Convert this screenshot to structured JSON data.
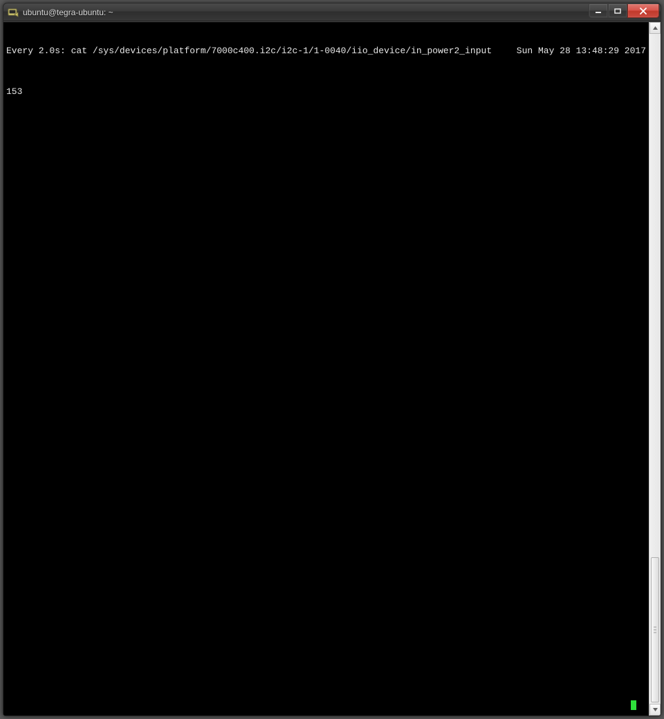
{
  "window": {
    "title": "ubuntu@tegra-ubuntu: ~"
  },
  "terminal": {
    "watch_prefix": "Every 2.0s: cat /sys/devices/platform/7000c400.i2c/i2c-1/1-0040/iio_device/in_power2_input",
    "timestamp": "Sun May 28 13:48:29 2017",
    "output_value": "153"
  }
}
